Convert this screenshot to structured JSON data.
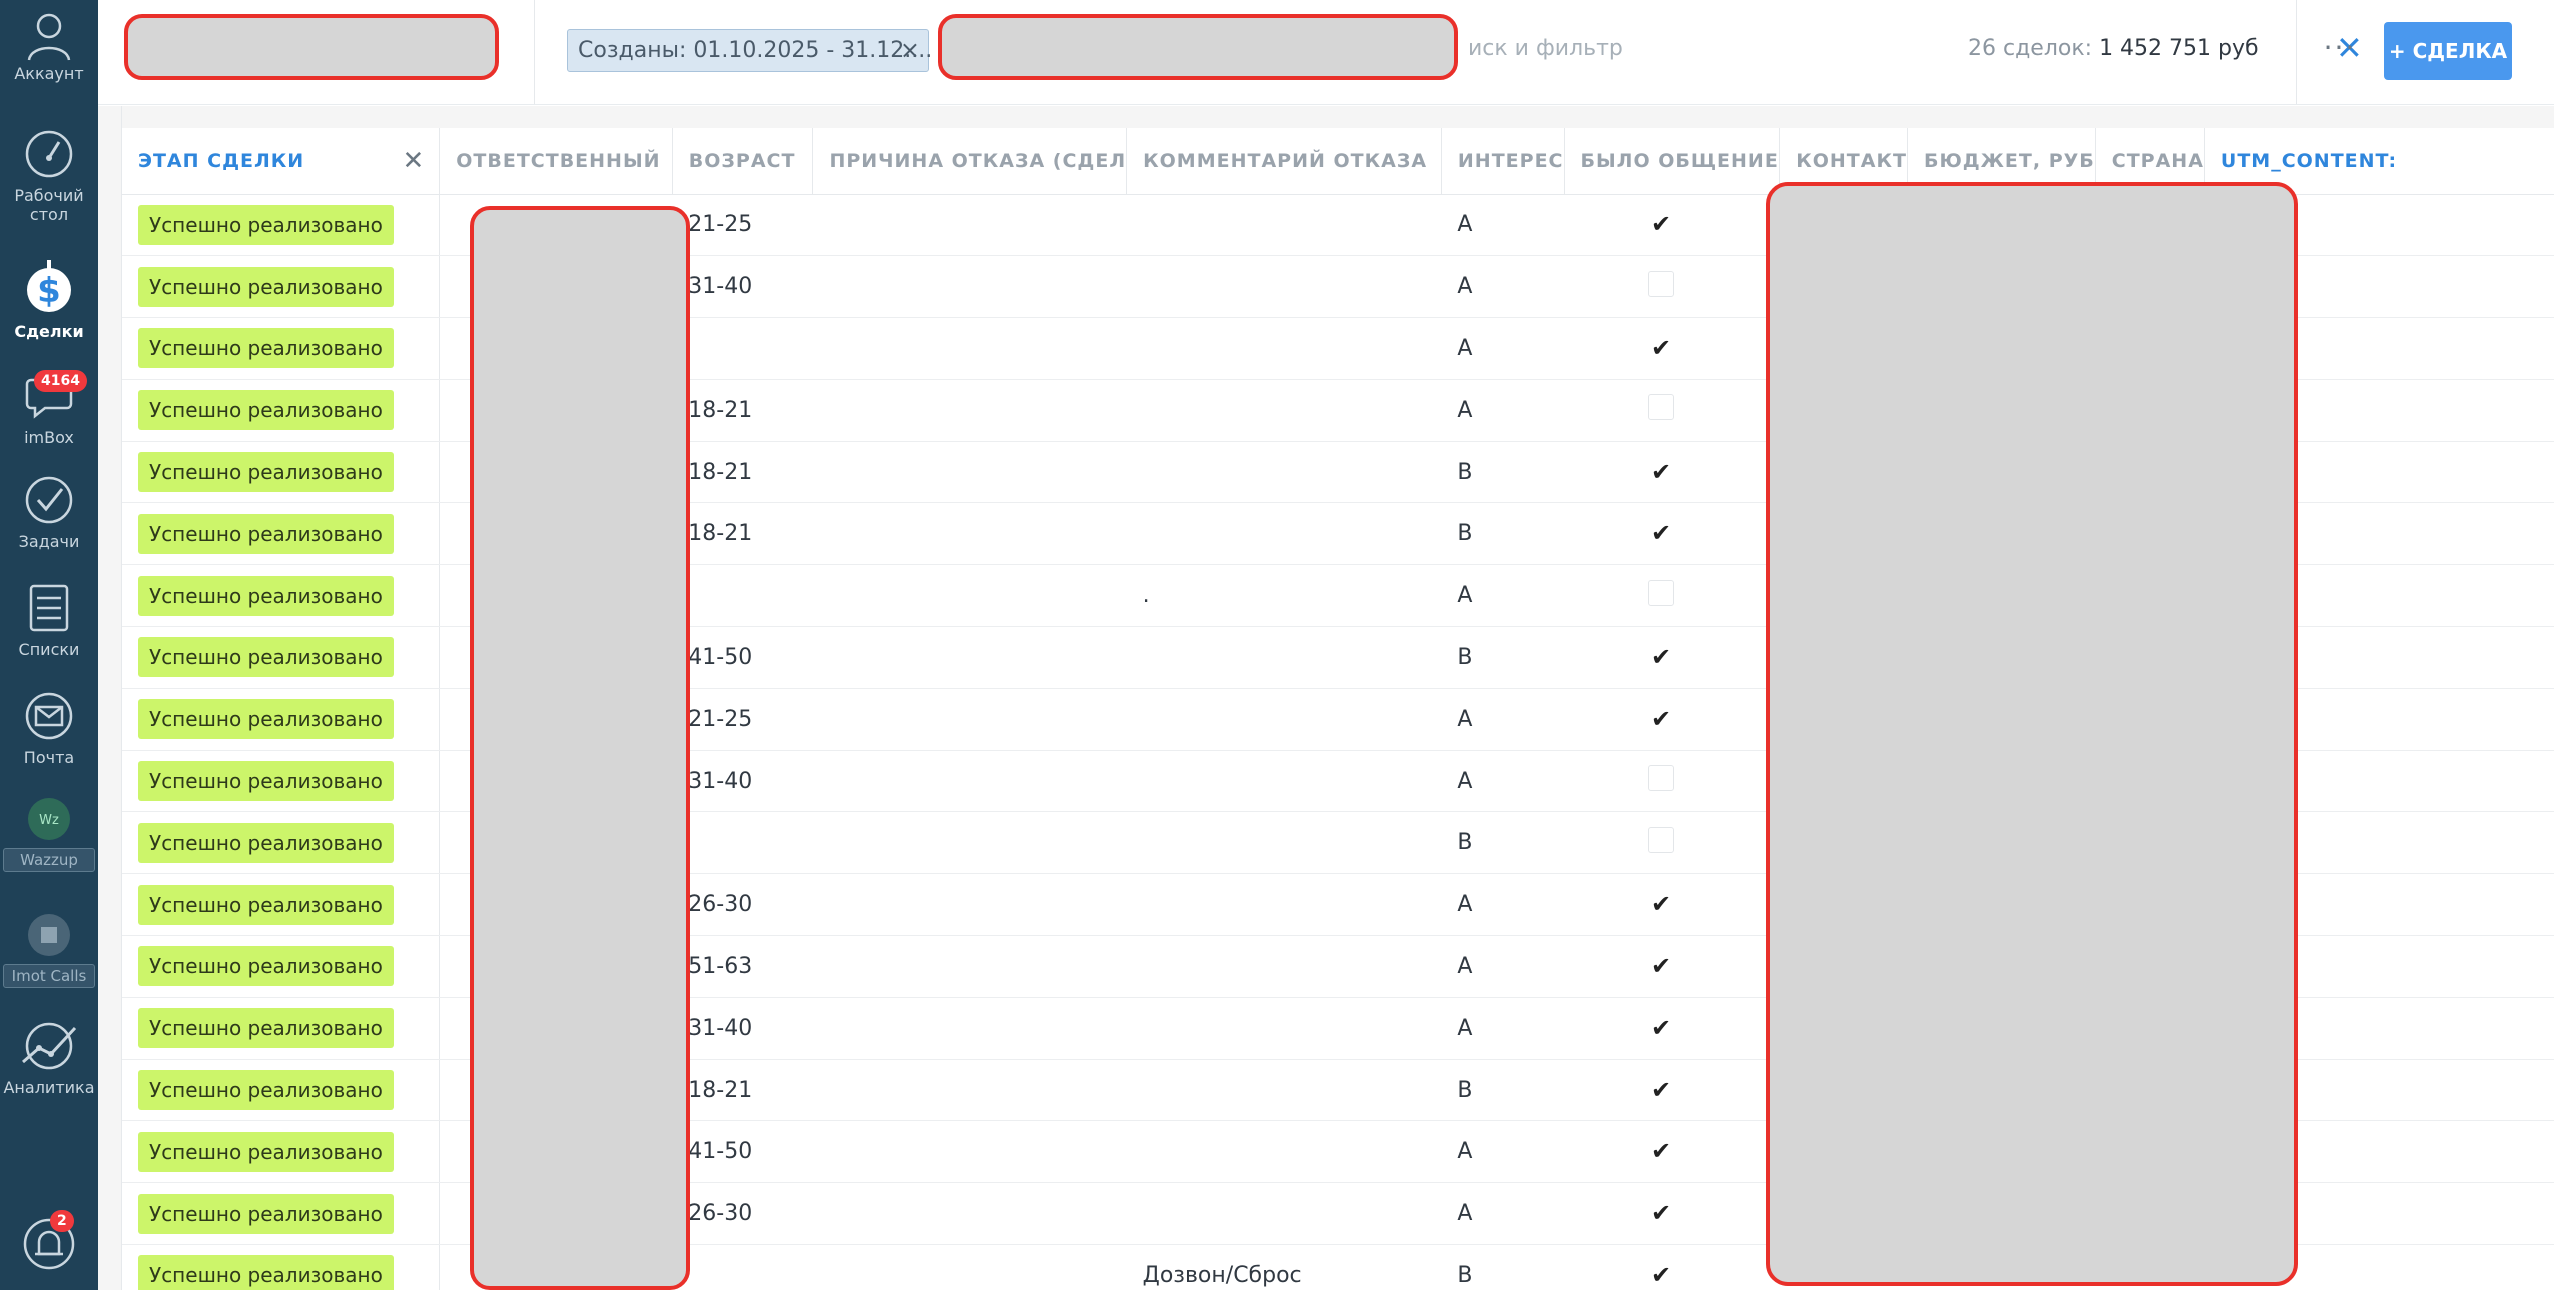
{
  "sidebar": {
    "account": "Аккаунт",
    "desktop": "Рабочий стол",
    "deals": "Сделки",
    "imbox": "imBox",
    "imbox_badge": "4164",
    "tasks": "Задачи",
    "lists": "Списки",
    "mail": "Почта",
    "wazzup_icon": "Wz",
    "wazzup": "Wazzup",
    "imot_calls": "Imot Calls",
    "analytics": "Аналитика",
    "notifications_badge": "2"
  },
  "topbar": {
    "filter_chip": "Созданы: 01.10.2025 - 31.12....",
    "filter_chip_close": "×",
    "search_placeholder": "иск и фильтр",
    "deals_count": "26 сделок:",
    "deals_sum": "1 452 751 руб",
    "summary_close": "✕",
    "more": "···",
    "new_deal": "+ СДЕЛКА"
  },
  "colors": {
    "sidebar_bg": "#1f4157",
    "stage_badge": "#ccf56a",
    "accent": "#2f86dc",
    "primary_button": "#4a98ee",
    "redaction_border": "#e9302a"
  },
  "table": {
    "columns": [
      "ЭТАП СДЕЛКИ",
      "ОТВЕТСТВЕННЫЙ",
      "ВОЗРАСТ",
      "ПРИЧИНА ОТКАЗА (СДЕЛ",
      "КОММЕНТАРИЙ ОТКАЗА",
      "ИНТЕРЕС",
      "БЫЛО ОБЩЕНИЕ",
      "КОНТАКТ",
      "БЮДЖЕТ, РУБ",
      "СТРАНА",
      "UTM_CONTENT:"
    ],
    "column_close": "✕",
    "rows": [
      {
        "stage": "Успешно реализовано",
        "age": "21-25",
        "reason": "",
        "comment": "",
        "interest": "A",
        "talked": true
      },
      {
        "stage": "Успешно реализовано",
        "age": "31-40",
        "reason": "",
        "comment": "",
        "interest": "A",
        "talked": false
      },
      {
        "stage": "Успешно реализовано",
        "age": "",
        "reason": "",
        "comment": "",
        "interest": "A",
        "talked": true
      },
      {
        "stage": "Успешно реализовано",
        "age": "18-21",
        "reason": "",
        "comment": "",
        "interest": "A",
        "talked": false
      },
      {
        "stage": "Успешно реализовано",
        "age": "18-21",
        "reason": "",
        "comment": "",
        "interest": "B",
        "talked": true
      },
      {
        "stage": "Успешно реализовано",
        "age": "18-21",
        "reason": "",
        "comment": "",
        "interest": "B",
        "talked": true
      },
      {
        "stage": "Успешно реализовано",
        "age": "",
        "reason": "",
        "comment": ".",
        "interest": "A",
        "talked": false
      },
      {
        "stage": "Успешно реализовано",
        "age": "41-50",
        "reason": "",
        "comment": "",
        "interest": "B",
        "talked": true
      },
      {
        "stage": "Успешно реализовано",
        "age": "21-25",
        "reason": "",
        "comment": "",
        "interest": "A",
        "talked": true
      },
      {
        "stage": "Успешно реализовано",
        "age": "31-40",
        "reason": "",
        "comment": "",
        "interest": "A",
        "talked": false
      },
      {
        "stage": "Успешно реализовано",
        "age": "",
        "reason": "",
        "comment": "",
        "interest": "B",
        "talked": false
      },
      {
        "stage": "Успешно реализовано",
        "age": "26-30",
        "reason": "",
        "comment": "",
        "interest": "A",
        "talked": true
      },
      {
        "stage": "Успешно реализовано",
        "age": "51-63",
        "reason": "",
        "comment": "",
        "interest": "A",
        "talked": true
      },
      {
        "stage": "Успешно реализовано",
        "age": "31-40",
        "reason": "",
        "comment": "",
        "interest": "A",
        "talked": true
      },
      {
        "stage": "Успешно реализовано",
        "age": "18-21",
        "reason": "",
        "comment": "",
        "interest": "B",
        "talked": true
      },
      {
        "stage": "Успешно реализовано",
        "age": "41-50",
        "reason": "",
        "comment": "",
        "interest": "A",
        "talked": true
      },
      {
        "stage": "Успешно реализовано",
        "age": "26-30",
        "reason": "",
        "comment": "",
        "interest": "A",
        "talked": true
      },
      {
        "stage": "Успешно реализовано",
        "age": "",
        "reason": "",
        "comment": "Дозвон/Сброс",
        "interest": "B",
        "talked": true
      }
    ]
  }
}
